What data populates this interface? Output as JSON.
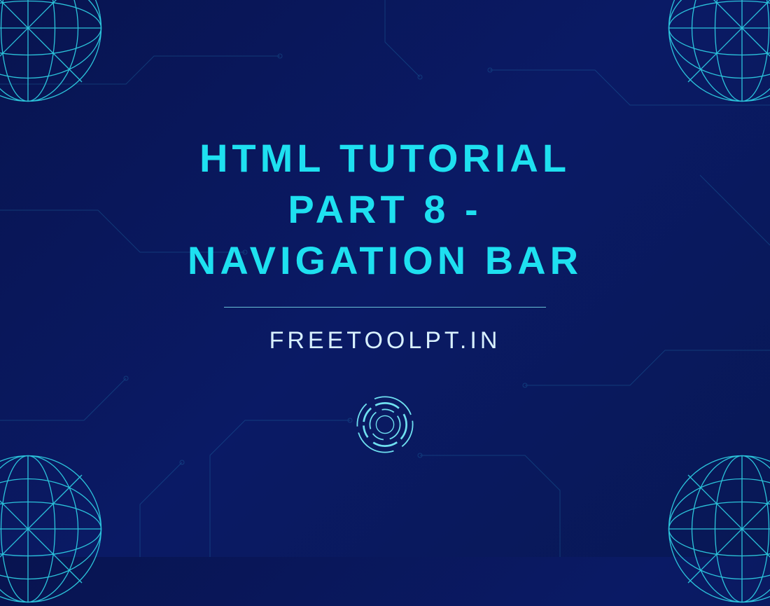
{
  "title_line1": "HTML TUTORIAL",
  "title_line2": "PART 8 -",
  "title_line3": "NAVIGATION BAR",
  "subtitle": "FREETOOLPT.IN",
  "colors": {
    "background": "#0a1a5e",
    "accent": "#1ee0f0",
    "text_light": "#d8f0ff",
    "wire": "#2fd5e8"
  }
}
